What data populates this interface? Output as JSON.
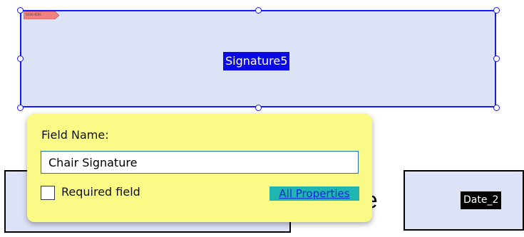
{
  "signature_field": {
    "label": "Signature5",
    "tag_text": "SIGN HERE",
    "tag_icon": "flag-icon"
  },
  "popup": {
    "title": "Field Name:",
    "field_name_value": "Chair Signature",
    "required_label": "Required field",
    "required_checked": false,
    "all_properties_link": "All Properties"
  },
  "background": {
    "partial_text": "te",
    "date_field_label": "Date_2"
  },
  "colors": {
    "field_fill": "#dde3f7",
    "selection_border": "#1717ff",
    "label_highlight": "#0a0ae6",
    "popup_background": "#fafa86",
    "link_highlight": "#1fb5b0",
    "tag_fill": "#f28080"
  }
}
